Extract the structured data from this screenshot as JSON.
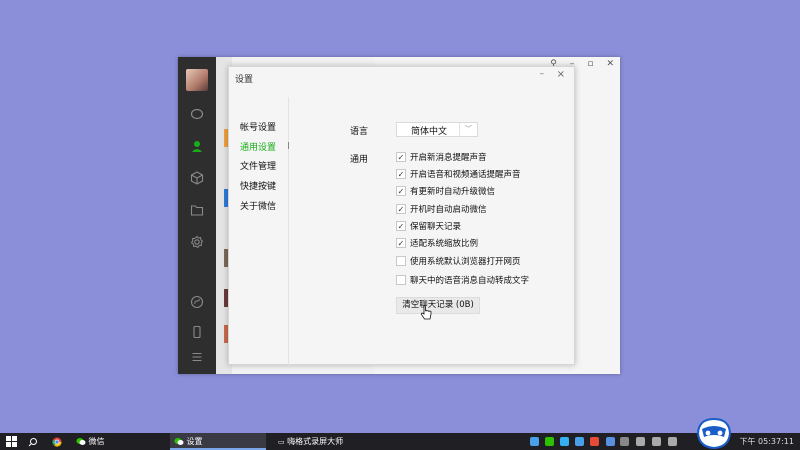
{
  "dialog": {
    "title": "设置",
    "minimize": "–",
    "close": "×"
  },
  "nav": {
    "items": [
      {
        "label": "帐号设置",
        "active": false
      },
      {
        "label": "通用设置",
        "active": true
      },
      {
        "label": "文件管理",
        "active": false
      },
      {
        "label": "快捷按键",
        "active": false
      },
      {
        "label": "关于微信",
        "active": false
      }
    ]
  },
  "general": {
    "language_label": "语言",
    "language_value": "简体中文",
    "general_label": "通用",
    "options": [
      {
        "label": "开启新消息提醒声音",
        "checked": true
      },
      {
        "label": "开启语音和视频通话提醒声音",
        "checked": true
      },
      {
        "label": "有更新时自动升级微信",
        "checked": true
      },
      {
        "label": "开机时自动启动微信",
        "checked": true
      },
      {
        "label": "保留聊天记录",
        "checked": true
      },
      {
        "label": "适配系统缩放比例",
        "checked": true
      },
      {
        "label": "使用系统默认浏览器打开网页",
        "checked": false
      },
      {
        "label": "聊天中的语音消息自动转成文字",
        "checked": false
      }
    ],
    "clear_button": "清空聊天记录 (0B)"
  },
  "taskbar": {
    "wechat_label": "微信",
    "settings_label": "设置",
    "recorder_label": "嗨格式录屏大师",
    "clock": "下午 05:37:11"
  },
  "colors": {
    "accent": "#1aad19",
    "desktop": "#8b8fd9",
    "sidebar": "#2e2e2e"
  }
}
